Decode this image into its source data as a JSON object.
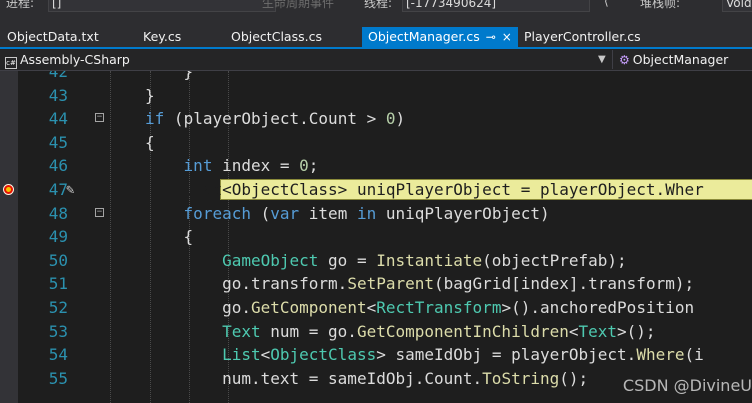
{
  "toolbar": {
    "process_label": "进程:",
    "process_value": "[]",
    "lifecycle_label": "生命周期事件",
    "thread_label": "线程:",
    "thread_value": "[-1773490624]",
    "stackframe_label": "堆栈帧:",
    "stackframe_value": "Void"
  },
  "tabs": [
    {
      "label": "ObjectData.txt"
    },
    {
      "label": "Key.cs"
    },
    {
      "label": "ObjectClass.cs"
    },
    {
      "label": "ObjectManager.cs",
      "pin": "⊸",
      "close": "×"
    },
    {
      "label": "PlayerController.cs"
    }
  ],
  "navbar": {
    "project": "Assembly-CSharp",
    "member": "ObjectManager",
    "dropdown_icon": "chevron-down-icon"
  },
  "editor": {
    "breakpoint_color": "#e51400",
    "highlight_color": "#ebeb9b",
    "lines": [
      {
        "n": "42",
        "tokens": [
          {
            "t": "}",
            "c": ""
          }
        ]
      },
      {
        "n": "43",
        "tokens": [
          {
            "t": "}",
            "c": ""
          }
        ]
      },
      {
        "n": "44",
        "fold": "−",
        "tokens": [
          {
            "t": "if",
            "c": "kw"
          },
          {
            "t": " (playerObject.Count > ",
            "c": ""
          },
          {
            "t": "0",
            "c": "nm"
          },
          {
            "t": ")",
            "c": ""
          }
        ]
      },
      {
        "n": "45",
        "tokens": [
          {
            "t": "{",
            "c": ""
          }
        ]
      },
      {
        "n": "46",
        "tokens": [
          {
            "t": "int",
            "c": "kw"
          },
          {
            "t": " index = ",
            "c": ""
          },
          {
            "t": "0",
            "c": "nm"
          },
          {
            "t": ";",
            "c": ""
          }
        ]
      },
      {
        "n": "47",
        "current": true,
        "tokens": [
          {
            "t": "List<ObjectClass> uniqPlayerObject = playerObject.Wher",
            "c": ""
          }
        ]
      },
      {
        "n": "48",
        "fold": "−",
        "tokens": [
          {
            "t": "foreach",
            "c": "kw"
          },
          {
            "t": " (",
            "c": ""
          },
          {
            "t": "var",
            "c": "kw"
          },
          {
            "t": " item ",
            "c": ""
          },
          {
            "t": "in",
            "c": "kw"
          },
          {
            "t": " uniqPlayerObject)",
            "c": ""
          }
        ]
      },
      {
        "n": "49",
        "tokens": [
          {
            "t": "{",
            "c": ""
          }
        ]
      },
      {
        "n": "50",
        "tokens": [
          {
            "t": "GameObject",
            "c": "ty"
          },
          {
            "t": " go = ",
            "c": ""
          },
          {
            "t": "Instantiate",
            "c": "mt"
          },
          {
            "t": "(objectPrefab);",
            "c": ""
          }
        ]
      },
      {
        "n": "51",
        "tokens": [
          {
            "t": "go.transform.",
            "c": ""
          },
          {
            "t": "SetParent",
            "c": "mt"
          },
          {
            "t": "(bagGrid[index].transform);",
            "c": ""
          }
        ]
      },
      {
        "n": "52",
        "tokens": [
          {
            "t": "go.",
            "c": ""
          },
          {
            "t": "GetComponent",
            "c": "mt"
          },
          {
            "t": "<",
            "c": ""
          },
          {
            "t": "RectTransform",
            "c": "ty"
          },
          {
            "t": ">().anchoredPosition",
            "c": ""
          }
        ]
      },
      {
        "n": "53",
        "tokens": [
          {
            "t": "Text",
            "c": "ty"
          },
          {
            "t": " num = go.",
            "c": ""
          },
          {
            "t": "GetComponentInChildren",
            "c": "mt"
          },
          {
            "t": "<",
            "c": ""
          },
          {
            "t": "Text",
            "c": "ty"
          },
          {
            "t": ">();",
            "c": ""
          }
        ]
      },
      {
        "n": "54",
        "tokens": [
          {
            "t": "List",
            "c": "ty"
          },
          {
            "t": "<",
            "c": ""
          },
          {
            "t": "ObjectClass",
            "c": "ty"
          },
          {
            "t": "> sameIdObj = playerObject.",
            "c": ""
          },
          {
            "t": "Where",
            "c": "mt"
          },
          {
            "t": "(i",
            "c": ""
          }
        ]
      },
      {
        "n": "55",
        "tokens": [
          {
            "t": "num.text = sameIdObj.Count.",
            "c": ""
          },
          {
            "t": "ToString",
            "c": "mt"
          },
          {
            "t": "();",
            "c": ""
          }
        ]
      }
    ]
  },
  "watermark": "CSDN @DivineU"
}
